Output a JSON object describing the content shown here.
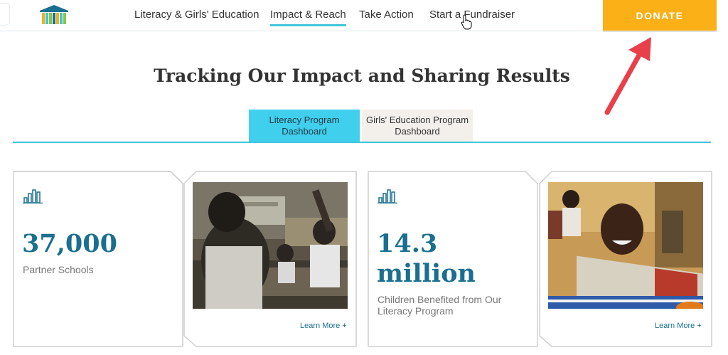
{
  "header": {
    "nav": [
      {
        "label": "Literacy & Girls' Education",
        "active": false
      },
      {
        "label": "Impact & Reach",
        "active": true
      },
      {
        "label": "Take Action",
        "active": false
      },
      {
        "label": "Start a Fundraiser",
        "active": false
      }
    ],
    "donate_label": "DONATE"
  },
  "page": {
    "title": "Tracking Our Impact and Sharing Results"
  },
  "tabs": [
    {
      "line1": "Literacy Program",
      "line2": "Dashboard",
      "active": true
    },
    {
      "line1": "Girls' Education Program",
      "line2": "Dashboard",
      "active": false
    }
  ],
  "stats": [
    {
      "number": "37,000",
      "label": "Partner Schools",
      "learn_more": "Learn More +",
      "icon": "bar-chart-icon"
    },
    {
      "number_line1": "14.3",
      "number_line2": "million",
      "label_line1": "Children Benefited from Our",
      "label_line2": "Literacy Program",
      "learn_more": "Learn More +",
      "icon": "bar-chart-icon"
    }
  ],
  "colors": {
    "accent": "#40d0ee",
    "donate": "#fbb017",
    "stat": "#1a6f8f",
    "annotation_arrow": "#e8404a"
  }
}
